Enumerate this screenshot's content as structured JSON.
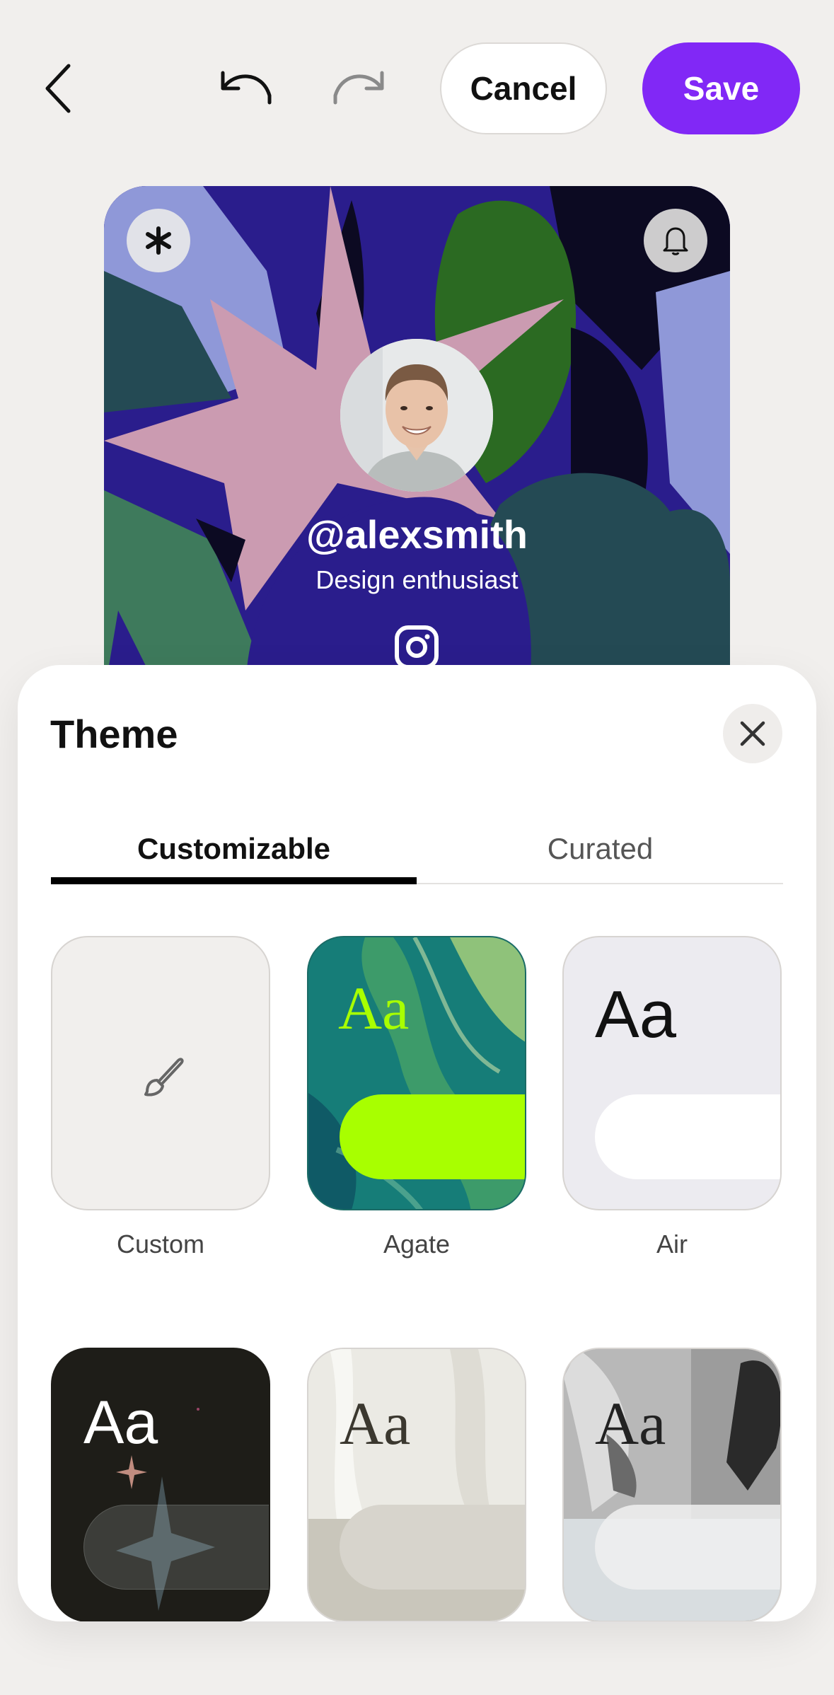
{
  "toolbar": {
    "back_icon": "chevron-left-icon",
    "undo_icon": "undo-icon",
    "redo_icon": "redo-icon",
    "cancel_label": "Cancel",
    "save_label": "Save",
    "save_color": "#8128f6"
  },
  "preview": {
    "logo_icon": "asterisk-logo-icon",
    "bell_icon": "bell-icon",
    "handle": "@alexsmith",
    "bio": "Design enthusiast",
    "social_icon": "instagram-icon"
  },
  "sheet": {
    "title": "Theme",
    "close_icon": "close-icon",
    "tabs": [
      {
        "label": "Customizable",
        "active": true
      },
      {
        "label": "Curated",
        "active": false
      }
    ],
    "themes": [
      {
        "label": "Custom",
        "icon": "paintbrush-icon"
      },
      {
        "label": "Agate",
        "sample": "Aa",
        "accent": "#a8ff00"
      },
      {
        "label": "Air",
        "sample": "Aa"
      },
      {
        "label": "",
        "sample": "Aa"
      },
      {
        "label": "",
        "sample": "Aa"
      },
      {
        "label": "",
        "sample": "Aa"
      }
    ]
  }
}
